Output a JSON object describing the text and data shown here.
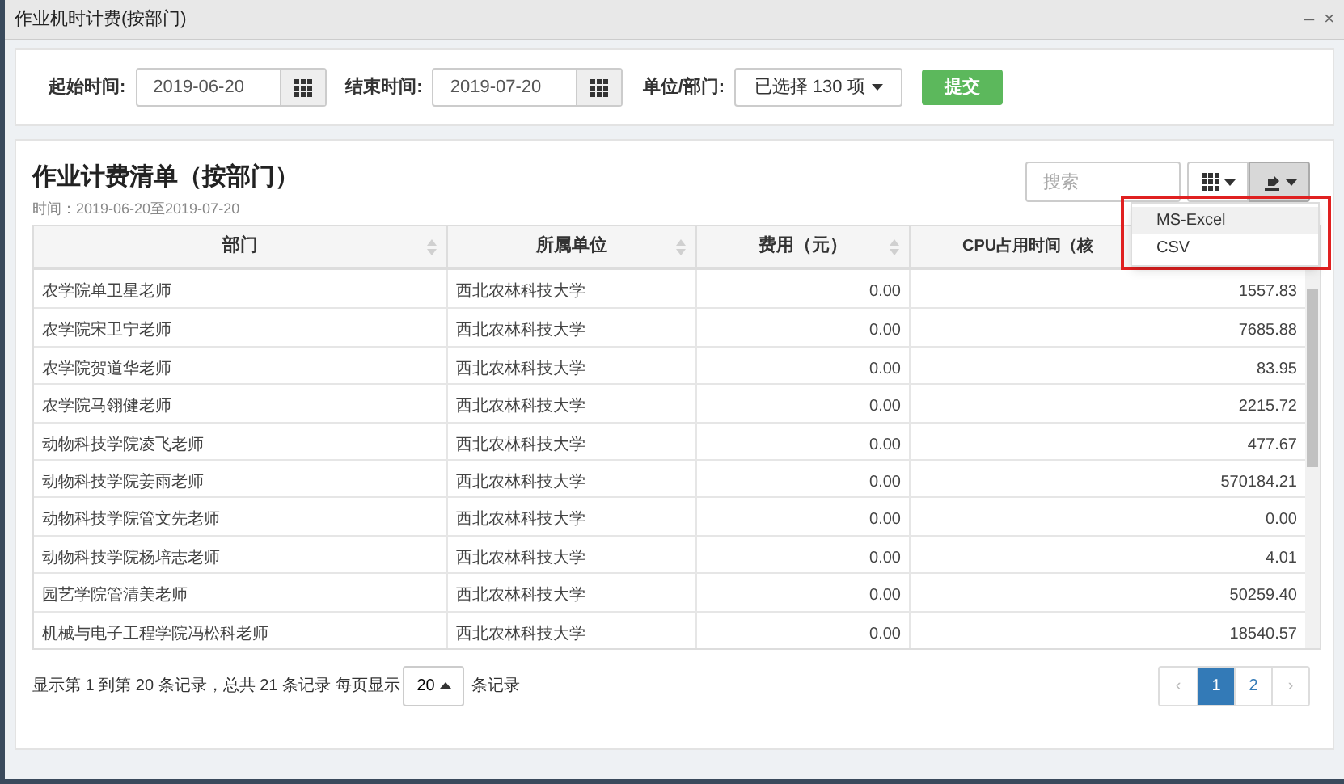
{
  "window": {
    "title": "作业机时计费(按部门)",
    "controls": [
      "–",
      "×"
    ]
  },
  "filters": [
    {
      "kind": "date",
      "label": "起始时间:",
      "value": "2019-06-20"
    },
    {
      "kind": "date",
      "label": "结束时间:",
      "value": "2019-07-20"
    },
    {
      "kind": "select",
      "label": "单位/部门:",
      "value": "已选择 130 项"
    }
  ],
  "submit": "提交",
  "report": {
    "title": "作业计费清单（按部门）",
    "subtitle": "时间：2019-06-20至2019-07-20",
    "search_placeholder": "搜索"
  },
  "table": {
    "columns": [
      "部门",
      "所属单位",
      "费用（元）",
      "CPU占用时间（核"
    ],
    "rows": [
      [
        "农学院单卫星老师",
        "西北农林科技大学",
        "0.00",
        "1557.83"
      ],
      [
        "农学院宋卫宁老师",
        "西北农林科技大学",
        "0.00",
        "7685.88"
      ],
      [
        "农学院贺道华老师",
        "西北农林科技大学",
        "0.00",
        "83.95"
      ],
      [
        "农学院马翎健老师",
        "西北农林科技大学",
        "0.00",
        "2215.72"
      ],
      [
        "动物科技学院凌飞老师",
        "西北农林科技大学",
        "0.00",
        "477.67"
      ],
      [
        "动物科技学院姜雨老师",
        "西北农林科技大学",
        "0.00",
        "570184.21"
      ],
      [
        "动物科技学院管文先老师",
        "西北农林科技大学",
        "0.00",
        "0.00"
      ],
      [
        "动物科技学院杨培志老师",
        "西北农林科技大学",
        "0.00",
        "4.01"
      ],
      [
        "园艺学院管清美老师",
        "西北农林科技大学",
        "0.00",
        "50259.40"
      ],
      [
        "机械与电子工程学院冯松科老师",
        "西北农林科技大学",
        "0.00",
        "18540.57"
      ]
    ]
  },
  "export_menu": [
    {
      "label": "MS-Excel",
      "selected": true
    },
    {
      "label": "CSV",
      "selected": false
    }
  ],
  "pagination": {
    "summary": "显示第 1 到第 20 条记录，总共 21 条记录 每页显示",
    "page_size": "20",
    "suffix": "条记录",
    "pages": [
      {
        "label": "‹",
        "kind": "prev",
        "selected": false
      },
      {
        "label": "1",
        "kind": "page",
        "selected": true
      },
      {
        "label": "2",
        "kind": "page",
        "selected": false
      },
      {
        "label": "›",
        "kind": "next",
        "selected": false
      }
    ]
  }
}
